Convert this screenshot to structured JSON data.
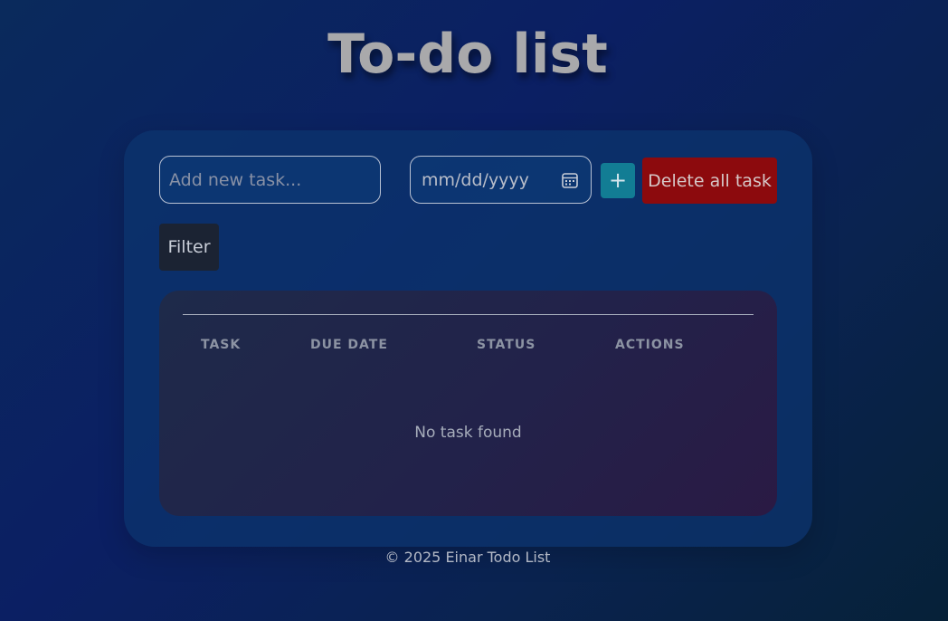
{
  "header": {
    "title": "To-do list"
  },
  "form": {
    "task_placeholder": "Add new task...",
    "date_placeholder": "mm/dd/yyyy",
    "add_label": "+",
    "delete_all_label": "Delete all task",
    "filter_label": "Filter"
  },
  "table": {
    "columns": [
      "TASK",
      "DUE DATE",
      "STATUS",
      "ACTIONS"
    ],
    "rows": [],
    "empty_message": "No task found"
  },
  "footer": {
    "text": "© 2025 Einar Todo List"
  },
  "colors": {
    "add_button": "#127d94",
    "delete_button": "#8c0a0d",
    "filter_button": "#1b2333",
    "title_text": "#a9a9ab"
  },
  "icons": {
    "calendar": "calendar-icon"
  }
}
